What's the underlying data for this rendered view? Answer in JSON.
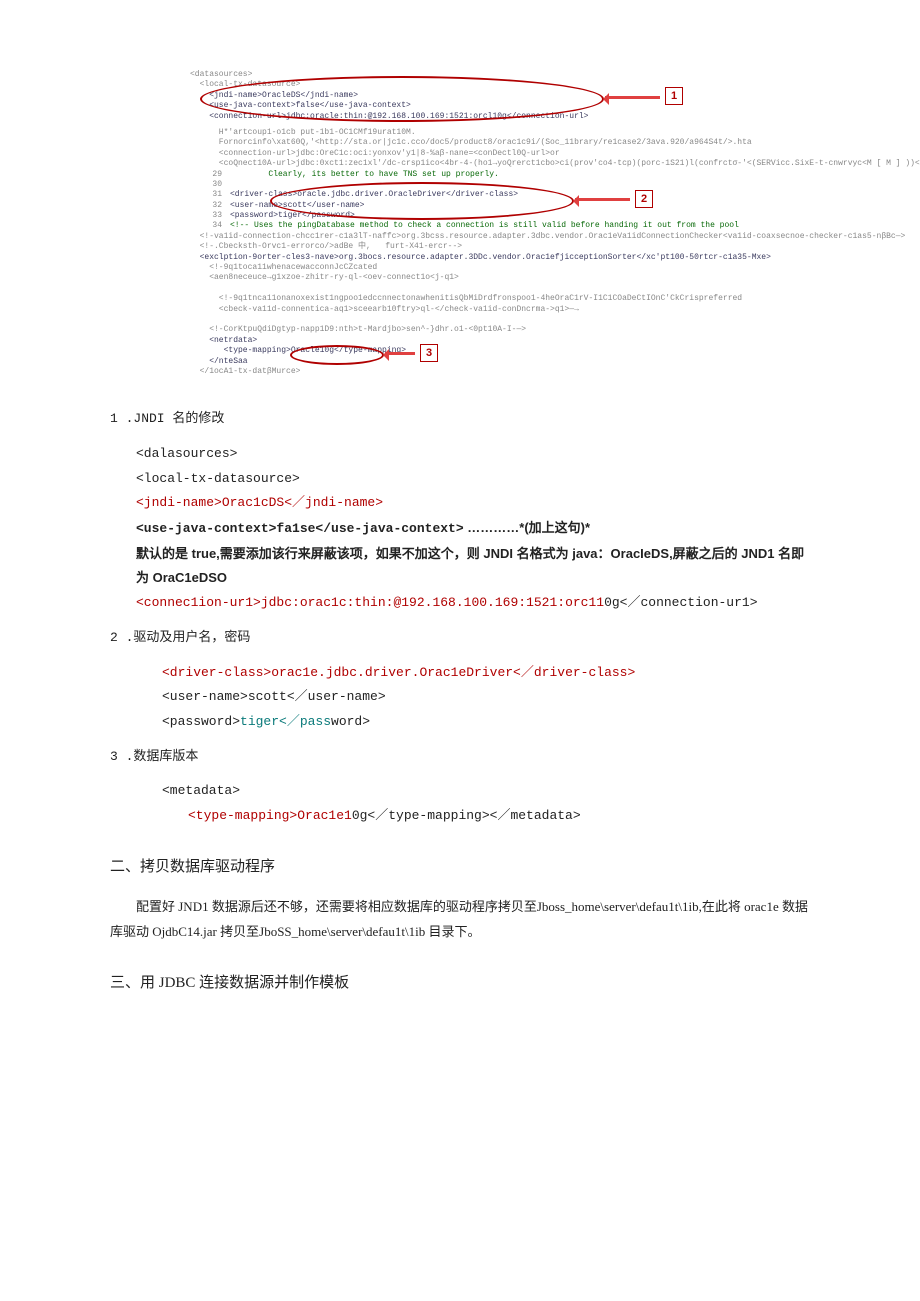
{
  "screenshot": {
    "l1": "<datasources>",
    "l2a": "  <local-tx-datasource>",
    "l2b": "    <jndi-name>OracleDS</jndi-name>",
    "l2c": "    <use-java-context>false</use-java-context>",
    "l2d": "    <connection-url>jdbc:oracle:thin:@192.168.100.169:1521:orcl10g</connection-url>",
    "l3": "      H*'artcoup1-o1cb put-1b1-OC1CMf19urat10M.",
    "l4": "      Fornorcinfo\\xat60Q,'<http://sta.or|jc1c.cco/doc5/product8/orac1c9i/(Soc_11brary/re1case2/3ava.920/a964S4t/>.hta",
    "l5": "      <connection-url>jdbc:OreC1c:oci:yonxov'y1|8-%aβ-nane=<conDectl0Q-url>or",
    "l6": "      <coQnect10A-url>jdbc:0xct1:zec1xl'/dc-crsp1ico<4br-4-(ho1→yoQrerct1cbo>ci(prov'co4-tcp)(porc-1S21)l(confrctσ-'<(SERVicc.SixE-t-cnwrvyc<M [ M ] ))</coaxteccon-url>",
    "l7": "        Clearly, its better to have TNS set up properly.",
    "l8": "<driver-class>oracle.jdbc.driver.OracleDriver</driver-class>",
    "l9": "<user-name>scott</user-name>",
    "l10": "<password>tiger</password>",
    "l11": "<!-- Uses the pingDatabase method to check a connection is still valid before handing it out from the pool",
    "l12": "  <!-va1id-connection-chcc1rer-c1a3lT-naffc>org.3bcss.resource.adapter.3dbc.vendor.Orac1eVa1idConnectionChecker<va1id-coaxsecnoe-checker-c1as5-nβBc—>",
    "l13": "  <!-.Cbecksth-Orvc1-errorco/>adBe 中,   furt-X41-ercr-->",
    "l14": "  <exclption-9orter-cles3-nave>org.3bocs.resource.adapter.3DDc.vendor.Orac1efjicceptionSorter</xc'pt100-50rtcr-c1a35-Mxe>",
    "l15": "    <!-9q1toca11whenacewacconnJcCZcated",
    "l16": "    <aen8neceuce→g1xzoe-zhitr-ry-ql-<oev-connect1o<j-q1>",
    "l17": " ",
    "l18": "      <!-9q1tnca11onanoxexist1ngpoo1edccnnectonawhenitisQbMiDrdfronspoo1-4heOraC1rV-I1C1COaDeCtIOnC'CkCrispreferred",
    "l19": "      <cbeck-va11d-connentica-aq1>sceearb10ftry>ql-</check-va1id-conDncrma->q1>—→",
    "l20": " ",
    "l21": "    <!-CorKtpuQdiDgtyp-napp1D9:nth>t-Mardjbo>sen^-}dhr.o1-<0pt10A-I-—>",
    "l22": "    <netrdata>",
    "l23": "       <type-mapping>Oracle10g</type-mapping>",
    "l24": "    </nteSaa",
    "l25": "  </1ocA1-tx-datβMurce>",
    "ln29": "29",
    "ln30": "30",
    "ln31": "31",
    "ln32": "32",
    "ln33": "33",
    "ln34": "34",
    "box1": "1",
    "box2": "2",
    "box3": "3"
  },
  "sec1": {
    "title": "1 .JNDI 名的修改",
    "l_ds": "<dalasources>",
    "l_ltx": "<local-tx-datasource>",
    "l_jndi": "<jndi-name>Orac1cDS<／jndi-name>",
    "l_use_a": "<use-java-context>fa1se</use-java-context>",
    "l_use_b": "…………*(加上这句)*",
    "l_note": "默认的是 true,需要添加该行来屏蔽该项，如果不加这个，则 JNDI 名格式为 java：OracIeDS,屏蔽之后的 JND1 名即为 OraC1eDSO",
    "l_conn_a": "<connec1ion-ur1>jdbc:orac1c:thin:@192.168.100.169:1521:orc11",
    "l_conn_b": "0g<／connection-ur1>"
  },
  "sec2": {
    "title": "2   .驱动及用户名，密码",
    "l_drv": "<driver-class>orac1e.jdbc.driver.Orac1eDriver<／driver-class>",
    "l_user": "<user-name>scott<／user-name>",
    "l_pass_a": "<password>",
    "l_pass_b": "tiger<／pass",
    "l_pass_c": "word>"
  },
  "sec3": {
    "title": "3   .数据库版本",
    "l_meta": "<metadata>",
    "l_type": "<type-mapping>Orac1e1",
    "l_type_b": "0g<／type-mapping><／metadata>"
  },
  "h2a": "二、拷贝数据库驱动程序",
  "para_a": "配置好 JND1 数据源后还不够，还需要将相应数据库的驱动程序拷贝至Jboss_home\\server\\defau1t\\1ib,在此将 orac1e 数据库驱动 OjdbC14.jar 拷贝至JboSS_home\\server\\defau1t\\1ib 目录下。",
  "h2b": "三、用 JDBC 连接数据源并制作模板"
}
